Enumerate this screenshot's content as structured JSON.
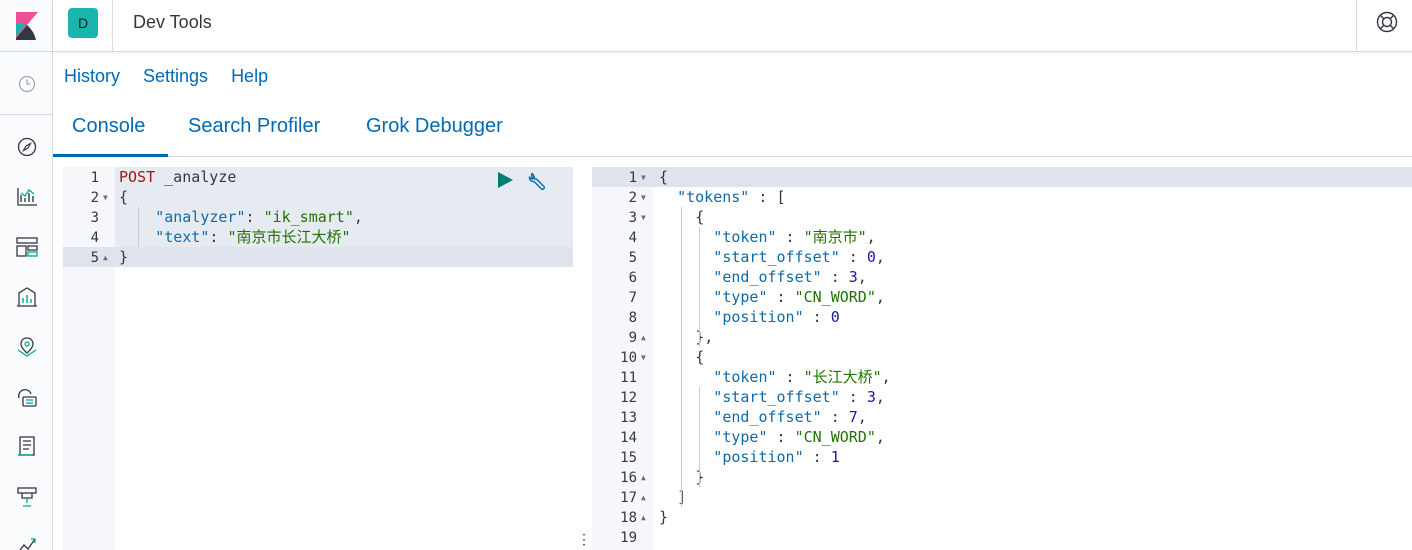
{
  "header": {
    "space_initial": "D",
    "title": "Dev Tools"
  },
  "top_menu": [
    "History",
    "Settings",
    "Help"
  ],
  "tabs": [
    "Console",
    "Search Profiler",
    "Grok Debugger"
  ],
  "colors": {
    "accent": "#006bb4",
    "space": "#1bb5ac",
    "run": "#017d73"
  },
  "nav_icons": [
    "clock-icon",
    "compass-icon",
    "visualize-icon",
    "dashboard-icon",
    "canvas-icon",
    "maps-icon",
    "ml-icon",
    "logs-icon",
    "infra-icon",
    "apm-icon"
  ],
  "request": {
    "lines": [
      {
        "n": "1",
        "fold": "",
        "text": "POST _analyze"
      },
      {
        "n": "2",
        "fold": "down",
        "text": "{"
      },
      {
        "n": "3",
        "fold": "",
        "key": "\"analyzer\"",
        "sep": ": ",
        "val": "\"ik_smart\"",
        "end": ","
      },
      {
        "n": "4",
        "fold": "",
        "key": "\"text\"",
        "sep": ": ",
        "val": "\"南京市长江大桥\"",
        "end": ""
      },
      {
        "n": "5",
        "fold": "up",
        "text": "}"
      }
    ],
    "method": "POST",
    "endpoint": "_analyze"
  },
  "response": {
    "lines": [
      {
        "n": "1",
        "fold": "down",
        "indent": 0,
        "text": "{"
      },
      {
        "n": "2",
        "fold": "down",
        "indent": 1,
        "key": "\"tokens\"",
        "sep": " : ",
        "tail": "["
      },
      {
        "n": "3",
        "fold": "down",
        "indent": 2,
        "text": "{"
      },
      {
        "n": "4",
        "fold": "",
        "indent": 3,
        "key": "\"token\"",
        "sep": " : ",
        "val": "\"南京市\"",
        "vtype": "str",
        "end": ","
      },
      {
        "n": "5",
        "fold": "",
        "indent": 3,
        "key": "\"start_offset\"",
        "sep": " : ",
        "val": "0",
        "vtype": "num",
        "end": ","
      },
      {
        "n": "6",
        "fold": "",
        "indent": 3,
        "key": "\"end_offset\"",
        "sep": " : ",
        "val": "3",
        "vtype": "num",
        "end": ","
      },
      {
        "n": "7",
        "fold": "",
        "indent": 3,
        "key": "\"type\"",
        "sep": " : ",
        "val": "\"CN_WORD\"",
        "vtype": "str",
        "end": ","
      },
      {
        "n": "8",
        "fold": "",
        "indent": 3,
        "key": "\"position\"",
        "sep": " : ",
        "val": "0",
        "vtype": "num",
        "end": ""
      },
      {
        "n": "9",
        "fold": "up",
        "indent": 2,
        "text": "},"
      },
      {
        "n": "10",
        "fold": "down",
        "indent": 2,
        "text": "{"
      },
      {
        "n": "11",
        "fold": "",
        "indent": 3,
        "key": "\"token\"",
        "sep": " : ",
        "val": "\"长江大桥\"",
        "vtype": "str",
        "end": ","
      },
      {
        "n": "12",
        "fold": "",
        "indent": 3,
        "key": "\"start_offset\"",
        "sep": " : ",
        "val": "3",
        "vtype": "num",
        "end": ","
      },
      {
        "n": "13",
        "fold": "",
        "indent": 3,
        "key": "\"end_offset\"",
        "sep": " : ",
        "val": "7",
        "vtype": "num",
        "end": ","
      },
      {
        "n": "14",
        "fold": "",
        "indent": 3,
        "key": "\"type\"",
        "sep": " : ",
        "val": "\"CN_WORD\"",
        "vtype": "str",
        "end": ","
      },
      {
        "n": "15",
        "fold": "",
        "indent": 3,
        "key": "\"position\"",
        "sep": " : ",
        "val": "1",
        "vtype": "num",
        "end": ""
      },
      {
        "n": "16",
        "fold": "up",
        "indent": 2,
        "text": "}"
      },
      {
        "n": "17",
        "fold": "up",
        "indent": 1,
        "text": "]"
      },
      {
        "n": "18",
        "fold": "up",
        "indent": 0,
        "text": "}"
      },
      {
        "n": "19",
        "fold": "",
        "indent": 0,
        "text": ""
      }
    ]
  },
  "resizer_glyph": "⋮"
}
